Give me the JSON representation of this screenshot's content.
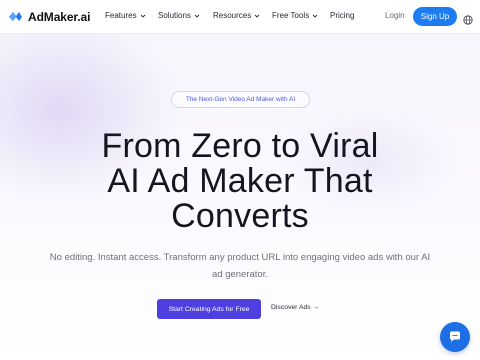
{
  "brand": {
    "name": "AdMaker.ai",
    "logo_icon": "admaker-logo-icon",
    "accent": "#1d7cf2"
  },
  "nav": {
    "items": [
      {
        "label": "Features",
        "has_dropdown": true
      },
      {
        "label": "Solutions",
        "has_dropdown": true
      },
      {
        "label": "Resources",
        "has_dropdown": true
      },
      {
        "label": "Free Tools",
        "has_dropdown": true
      },
      {
        "label": "Pricing",
        "has_dropdown": false
      }
    ],
    "login_label": "Login",
    "signup_label": "Sign Up",
    "language_icon": "globe-icon"
  },
  "hero": {
    "badge": "The Next-Gen Video Ad Maker with AI",
    "headline": [
      "From Zero to Viral",
      "AI Ad Maker That",
      "Converts"
    ],
    "subheadline": [
      "No editing. Instant access. Transform any product URL into engaging video ads with our AI",
      "ad generator."
    ],
    "primary_cta": "Start Creating Ads for Free",
    "secondary_cta": "Discover Ads →",
    "cta_color": "#4e3fe0"
  },
  "chat_widget": {
    "icon": "chat-bubble-icon",
    "color": "#1d6fe5"
  }
}
